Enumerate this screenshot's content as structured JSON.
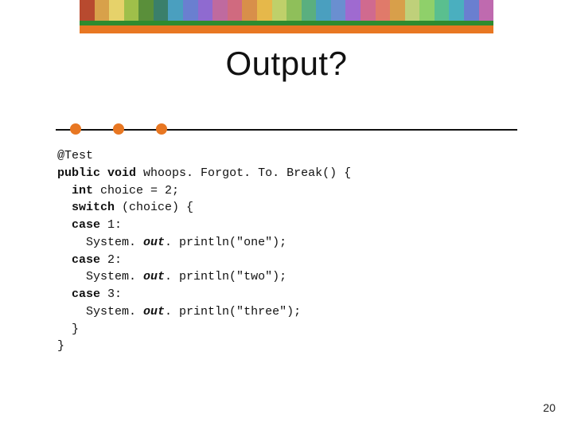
{
  "slide": {
    "title": "Output?",
    "page_number": "20"
  },
  "code": {
    "l1_annotation": "@Test",
    "l2_public": "public",
    "l2_void": "void",
    "l2_rest": " whoops. Forgot. To. Break() {",
    "l3_int": "int",
    "l3_rest": " choice = 2;",
    "l4_switch": "switch",
    "l4_rest": " (choice) {",
    "l5_case": "case",
    "l5_rest": " 1:",
    "l6_pre": "    System. ",
    "l6_out": "out",
    "l6_post": ". println(\"one\");",
    "l7_case": "case",
    "l7_rest": " 2:",
    "l8_pre": "    System. ",
    "l8_out": "out",
    "l8_post": ". println(\"two\");",
    "l9_case": "case",
    "l9_rest": " 3:",
    "l10_pre": "    System. ",
    "l10_out": "out",
    "l10_post": ". println(\"three\");",
    "l11": "  }",
    "l12": "}"
  },
  "mosaic_colors": [
    "#b84a2f",
    "#d8a14a",
    "#e6d26a",
    "#9fbf4a",
    "#5a8f3a",
    "#3a7f6a",
    "#4a9fbf",
    "#6a7fd0",
    "#8f6ad0",
    "#bf6a9f",
    "#d06a7f",
    "#d88f4a",
    "#e6b84a",
    "#bfd06a",
    "#8fbf5a",
    "#5aaf7f",
    "#4a9fbf",
    "#6a8fd0",
    "#9f6ad0",
    "#d06a8f",
    "#e07a6a",
    "#d89f4a",
    "#bfd07a",
    "#8fd06a",
    "#5abf8f",
    "#4aafbf",
    "#6a7fd0",
    "#bf6aaf"
  ]
}
